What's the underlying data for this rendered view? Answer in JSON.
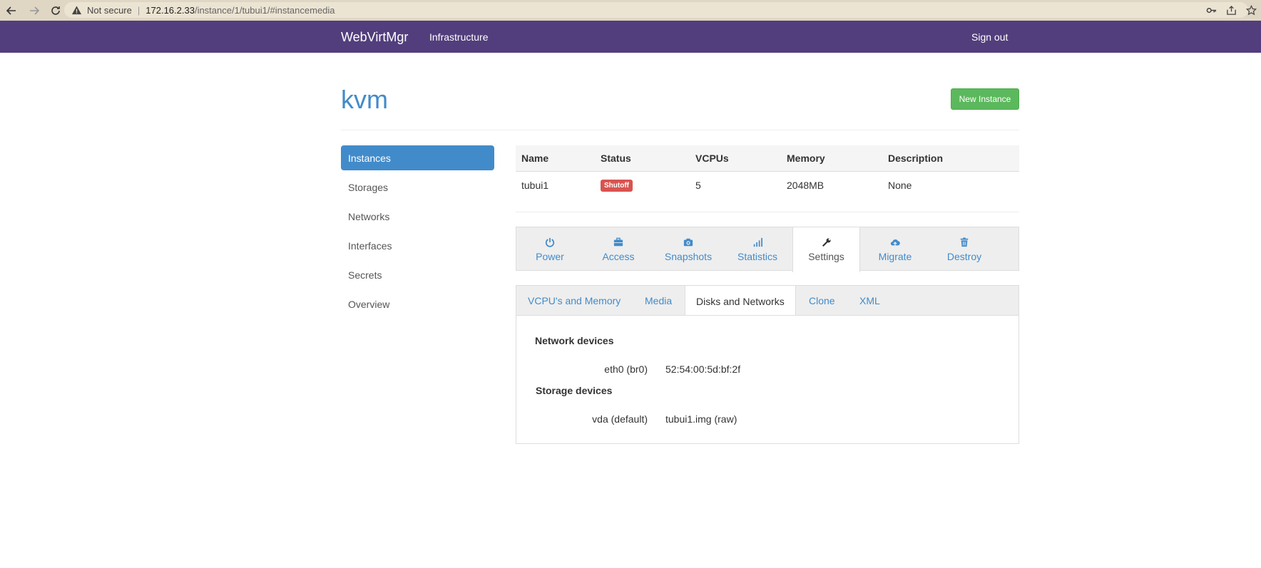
{
  "browser": {
    "not_secure": "Not secure",
    "url_host": "172.16.2.33",
    "url_path": "/instance/1/tubui1/#instancemedia"
  },
  "navbar": {
    "brand": "WebVirtMgr",
    "link": "Infrastructure",
    "signout": "Sign out",
    "bg_color": "#523e7c"
  },
  "header": {
    "title": "kvm",
    "new_instance": "New Instance"
  },
  "sidebar": {
    "items": [
      {
        "label": "Instances",
        "active": true
      },
      {
        "label": "Storages"
      },
      {
        "label": "Networks"
      },
      {
        "label": "Interfaces"
      },
      {
        "label": "Secrets"
      },
      {
        "label": "Overview"
      }
    ]
  },
  "table": {
    "headers": [
      "Name",
      "Status",
      "VCPUs",
      "Memory",
      "Description"
    ],
    "row": {
      "name": "tubui1",
      "status": "Shutoff",
      "vcpus": "5",
      "memory": "2048MB",
      "description": "None"
    }
  },
  "actions": [
    {
      "label": "Power",
      "icon": "power-icon"
    },
    {
      "label": "Access",
      "icon": "briefcase-icon"
    },
    {
      "label": "Snapshots",
      "icon": "camera-icon"
    },
    {
      "label": "Statistics",
      "icon": "stats-icon"
    },
    {
      "label": "Settings",
      "icon": "wrench-icon",
      "active": true
    },
    {
      "label": "Migrate",
      "icon": "cloud-upload-icon"
    },
    {
      "label": "Destroy",
      "icon": "trash-icon"
    }
  ],
  "subtabs": [
    {
      "label": "VCPU's and Memory"
    },
    {
      "label": "Media"
    },
    {
      "label": "Disks and Networks",
      "active": true
    },
    {
      "label": "Clone"
    },
    {
      "label": "XML"
    }
  ],
  "panel": {
    "network_title": "Network devices",
    "network": {
      "label": "eth0 (br0)",
      "value": "52:54:00:5d:bf:2f"
    },
    "storage_title": "Storage devices",
    "storage": {
      "label": "vda (default)",
      "value": "tubui1.img (raw)"
    }
  }
}
